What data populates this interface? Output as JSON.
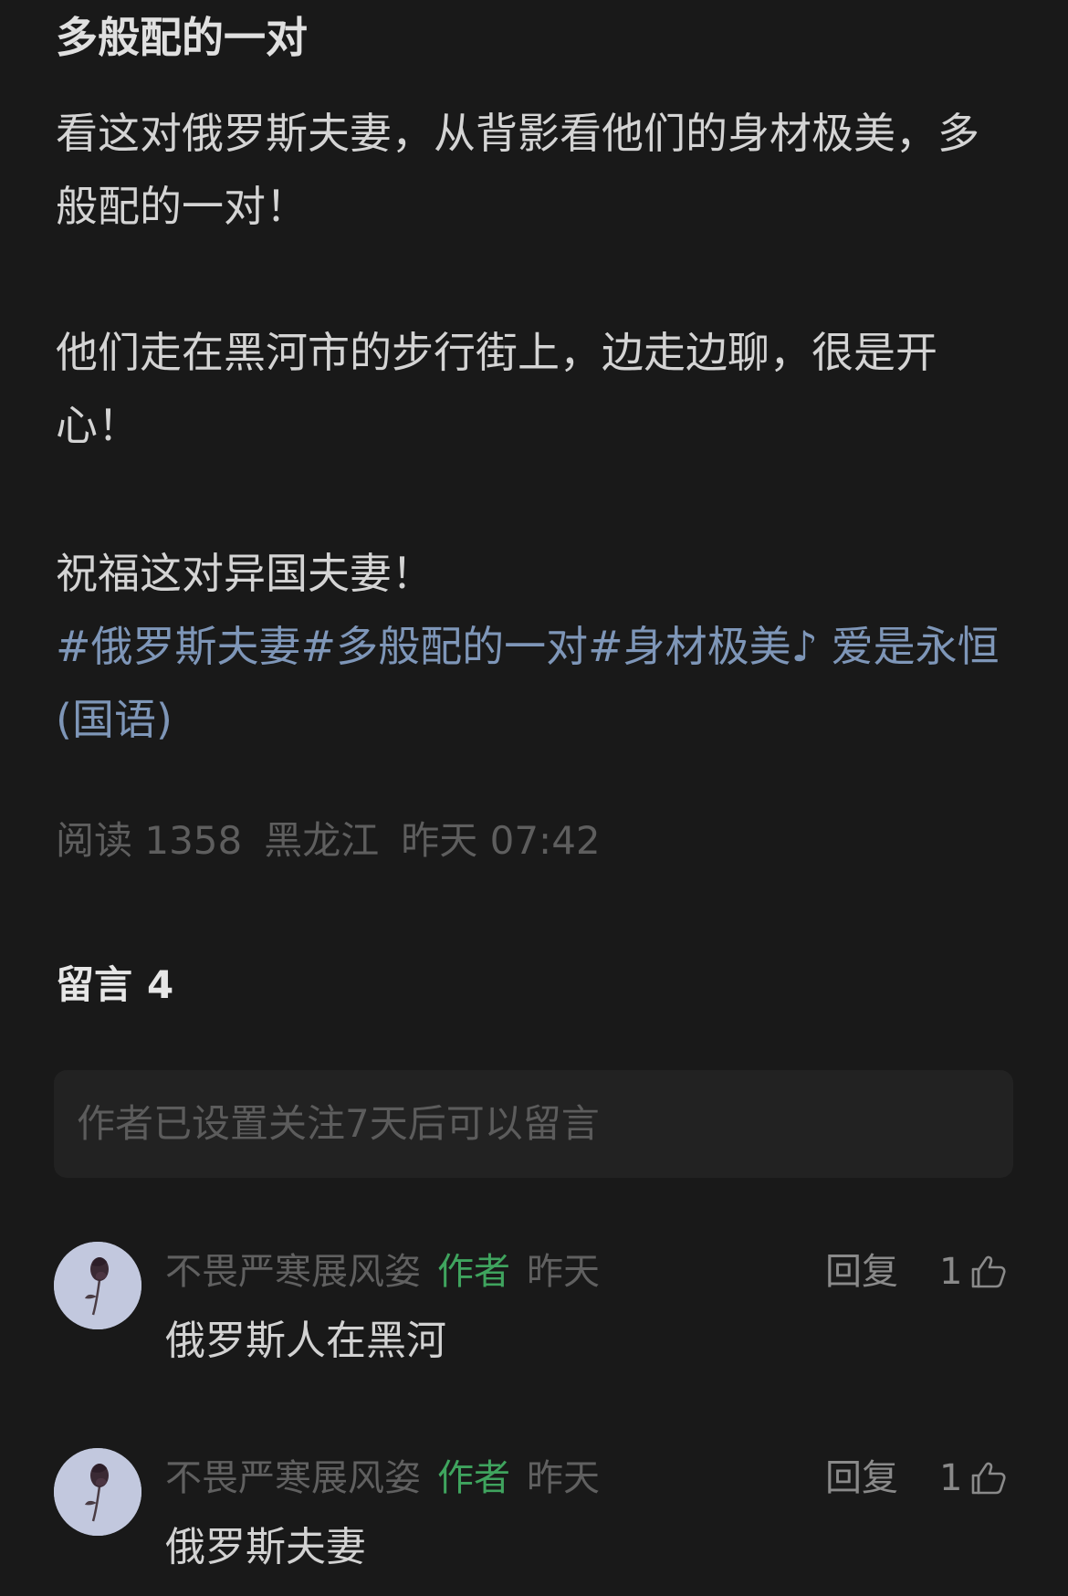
{
  "article": {
    "title": "多般配的一对",
    "paragraphs": [
      "看这对俄罗斯夫妻，从背影看他们的身材极美，多般配的一对！",
      "他们走在黑河市的步行街上，边走边聊，很是开心！",
      "祝福这对异国夫妻！"
    ],
    "tags": [
      "#俄罗斯夫妻",
      "#多般配的一对",
      "#身材极美"
    ],
    "music": "♪ 爱是永恒 (国语)",
    "meta": {
      "reads_label": "阅读 1358",
      "location": "黑龙江",
      "time": "昨天 07:42"
    }
  },
  "comments_section": {
    "label": "留言",
    "count": "4",
    "notice": "作者已设置关注7天后可以留言",
    "items": [
      {
        "author": "不畏严寒展风姿",
        "badge": "作者",
        "time": "昨天",
        "text": "俄罗斯人在黑河",
        "reply_label": "回复",
        "likes": "1",
        "avatar_icon": "flower-avatar"
      },
      {
        "author": "不畏严寒展风姿",
        "badge": "作者",
        "time": "昨天",
        "text": "俄罗斯夫妻",
        "reply_label": "回复",
        "likes": "1",
        "avatar_icon": "flower-avatar"
      }
    ]
  },
  "colors": {
    "background": "#191919",
    "hashtag": "#7e96b8",
    "author_badge": "#3fa45e",
    "muted_text": "#5e5e5e"
  }
}
